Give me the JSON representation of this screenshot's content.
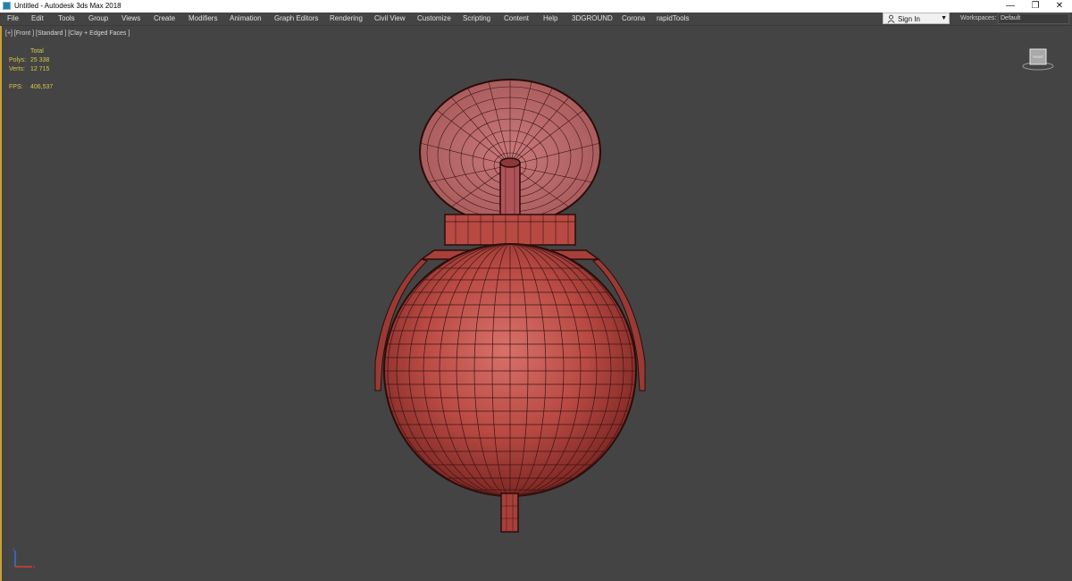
{
  "window": {
    "title": "Untitled - Autodesk 3ds Max 2018",
    "minimize_glyph": "—",
    "restore_glyph": "❐",
    "close_glyph": "✕"
  },
  "menu": {
    "items": [
      "File",
      "Edit",
      "Tools",
      "Group",
      "Views",
      "Create",
      "Modifiers",
      "Animation",
      "Graph Editors",
      "Rendering",
      "Civil View",
      "Customize",
      "Scripting",
      "Content",
      "Help",
      "3DGROUND",
      "Corona",
      "rapidTools"
    ]
  },
  "account": {
    "sign_in_label": "Sign In",
    "workspaces_label": "Workspaces:",
    "workspace_value": "Default"
  },
  "viewport": {
    "label": "[+] [Front ] [Standard ] [Clay + Edged Faces ]",
    "stats": {
      "header": "Total",
      "polys_label": "Polys:",
      "polys_value": "25 338",
      "verts_label": "Verts:",
      "verts_value": "12 715",
      "fps_label": "FPS:",
      "fps_value": "406,537"
    },
    "viewcube_label": "FRONT"
  },
  "colors": {
    "viewport_bg": "#444444",
    "active_border": "#c8a036",
    "stats_text": "#d6c64a",
    "model_fill": "#b0403a",
    "wire": "#2a0c0a"
  },
  "icons": [
    "app-icon",
    "user-icon",
    "dropdown-arrow-icon",
    "viewcube-icon",
    "axis-tripod-icon"
  ]
}
